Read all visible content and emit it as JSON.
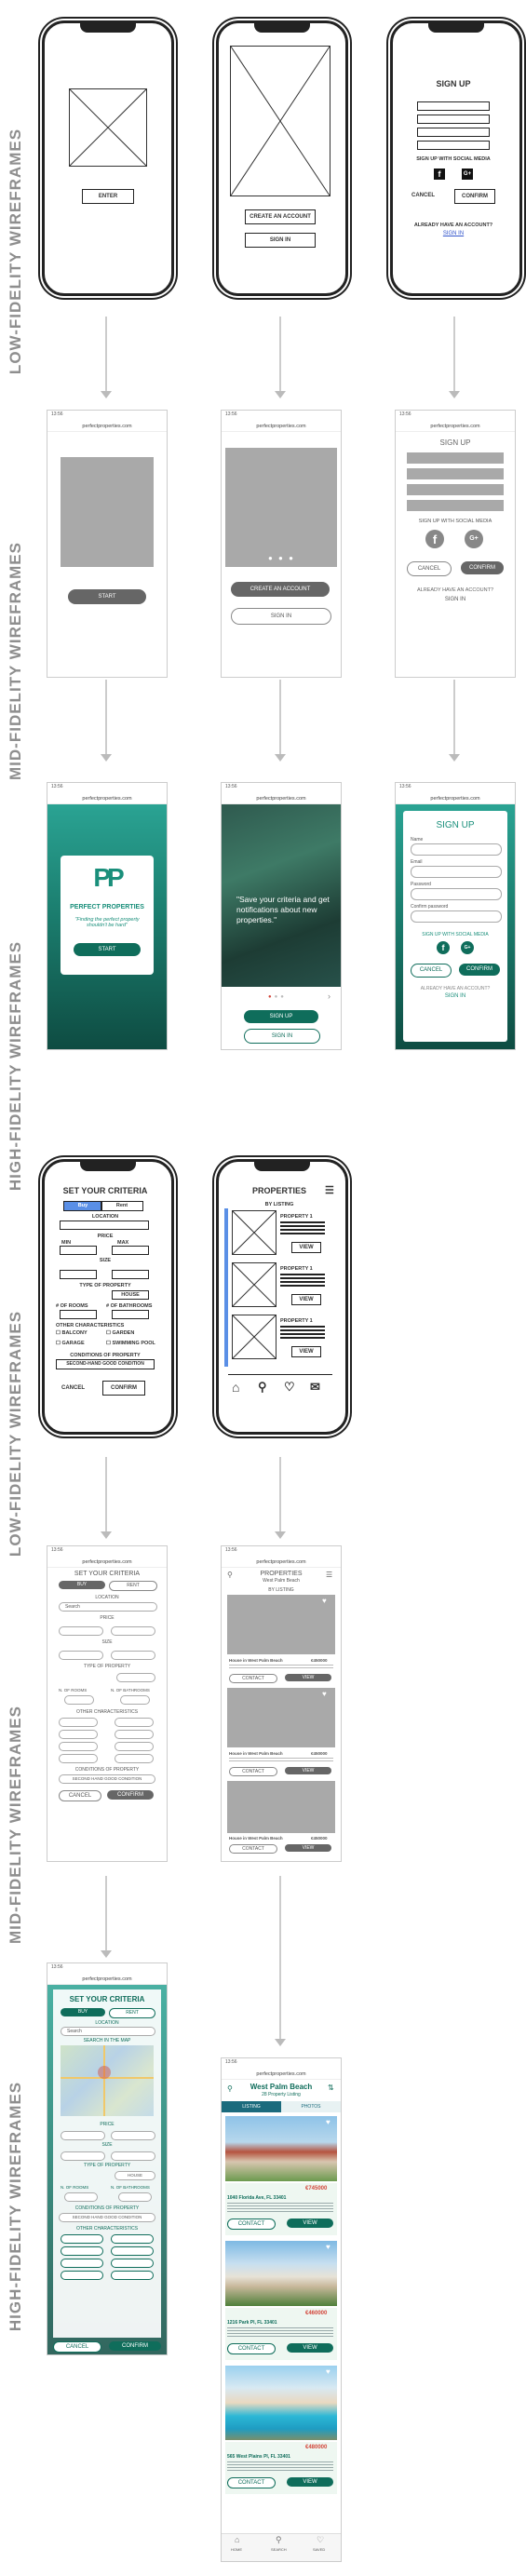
{
  "stages": {
    "lofi_1": "LOW-FIDELITY WIREFRAMES",
    "midfi_1": "MID-FIDELITY WIREFRAMES",
    "hifi_1": "HIGH-FIDELITY WIREFRAMES",
    "lofi_2": "LOW-FIDELITY WIREFRAMES",
    "midfi_2": "MID-FIDELITY WIREFRAMES",
    "hifi_2": "HIGH-FIDELITY WIREFRAMES"
  },
  "browser": {
    "time": "13:56",
    "url": "perfectproperties.com",
    "aa": "AA"
  },
  "lofi1": {
    "enter": "ENTER",
    "create_account": "CREATE AN ACCOUNT",
    "sign_in": "SIGN IN",
    "sign_up": "SIGN UP",
    "social": "SIGN UP WITH SOCIAL MEDIA",
    "cancel": "CANCEL",
    "confirm": "CONFIRM",
    "already": "ALREADY HAVE AN ACCOUNT?",
    "sign_in_link": "SIGN IN"
  },
  "midfi1": {
    "start": "START",
    "create_account": "CREATE AN ACCOUNT",
    "sign_in": "SIGN IN",
    "sign_up": "SIGN UP",
    "social": "SIGN UP WITH SOCIAL MEDIA",
    "cancel": "CANCEL",
    "confirm": "CONFIRM",
    "already": "ALREADY HAVE AN ACCOUNT?",
    "sign_in_link": "SIGN IN"
  },
  "hifi1": {
    "logo_letters": "PP",
    "brand": "PERFECT PROPERTIES",
    "tagline": "\"Finding the perfect property shouldn't be hard\"",
    "start": "START",
    "quote": "\"Save your criteria and get notifications about new properties.\"",
    "sign_up": "SIGN UP",
    "sign_in": "SIGN IN",
    "heading": "SIGN UP",
    "field_name": "Name",
    "field_email": "Email",
    "field_password": "Password",
    "field_confirm": "Confirm password",
    "social": "SIGN UP WITH SOCIAL MEDIA",
    "cancel": "CANCEL",
    "confirm": "CONFIRM",
    "already": "ALREADY HAVE AN ACCOUNT?",
    "sign_in_link": "SIGN IN"
  },
  "lofi2": {
    "criteria_title": "SET YOUR CRITERIA",
    "buy": "Buy",
    "rent": "Rent",
    "location": "LOCATION",
    "price": "PRICE",
    "min": "MIN",
    "max": "MAX",
    "size": "SIZE",
    "type": "TYPE OF PROPERTY",
    "house": "HOUSE",
    "bedrooms": "# OF ROOMS",
    "bathrooms": "# OF BATHROOMS",
    "other": "OTHER CHARACTERISTICS",
    "balcony": "BALCONY",
    "garden": "GARDEN",
    "garage": "GARAGE",
    "pool": "SWIMMING POOL",
    "condition": "CONDITIONS OF PROPERTY",
    "condition_value": "SECOND-HAND GOOD CONDITION",
    "cancel": "CANCEL",
    "confirm": "CONFIRM",
    "properties_title": "PROPERTIES",
    "by_listing": "BY LISTING",
    "property_1": "PROPERTY 1",
    "view": "VIEW"
  },
  "midfi2": {
    "criteria_title": "SET YOUR CRITERIA",
    "buy": "BUY",
    "rent": "RENT",
    "location": "LOCATION",
    "search": "Search",
    "price": "PRICE",
    "size": "SIZE",
    "type": "TYPE OF PROPERTY",
    "bedrooms": "N. OF ROOMS",
    "bathrooms": "N. OF BATHROOMS",
    "other": "OTHER CHARACTERISTICS",
    "condition": "CONDITIONS OF PROPERTY",
    "condition_value": "SECOND HAND GOOD CONDITION",
    "cancel": "CANCEL",
    "confirm": "CONFIRM",
    "properties_title": "PROPERTIES",
    "properties_sub": "West Palm Beach",
    "by_listing": "BY LISTING",
    "card_title": "House in West Palm Beach",
    "card_price": "€450000",
    "contact": "CONTACT",
    "view": "VIEW"
  },
  "hifi2": {
    "criteria_title": "SET YOUR CRITERIA",
    "buy": "BUY",
    "rent": "RENT",
    "location": "LOCATION",
    "search": "Search",
    "search_map": "SEARCH IN THE MAP",
    "price": "PRICE",
    "size": "SIZE",
    "type": "TYPE OF PROPERTY",
    "house": "HOUSE",
    "bedrooms": "N. OF ROOMS",
    "bathrooms": "N. OF BATHROOMS",
    "condition": "CONDITIONS OF PROPERTY",
    "condition_value": "SECOND HAND GOOD CONDITION",
    "other": "OTHER CHARACTERISTICS",
    "cancel": "CANCEL",
    "confirm": "CONFIRM",
    "city": "West Palm Beach",
    "count": "28 Property Listing",
    "tab_listing": "LISTING",
    "tab_photos": "PHOTOS",
    "cards": [
      {
        "price": "€745000",
        "address": "1040 Florida Ave, FL 33401",
        "contact": "CONTACT",
        "view": "VIEW"
      },
      {
        "price": "€460000",
        "address": "1216 Park Pl, FL 33401",
        "contact": "CONTACT",
        "view": "VIEW"
      },
      {
        "price": "€480000",
        "address": "565 West Plains Pl, FL 33401",
        "contact": "CONTACT",
        "view": "VIEW"
      }
    ],
    "nav_home": "HOME",
    "nav_search": "SEARCH",
    "nav_saved": "SAVED"
  },
  "colors": {
    "teal": "#0f6d5b",
    "teal_light": "#2aa393",
    "price_red": "#d3463a",
    "wire_gray": "#a9a9a9",
    "label_gray": "#8e8e8e"
  }
}
